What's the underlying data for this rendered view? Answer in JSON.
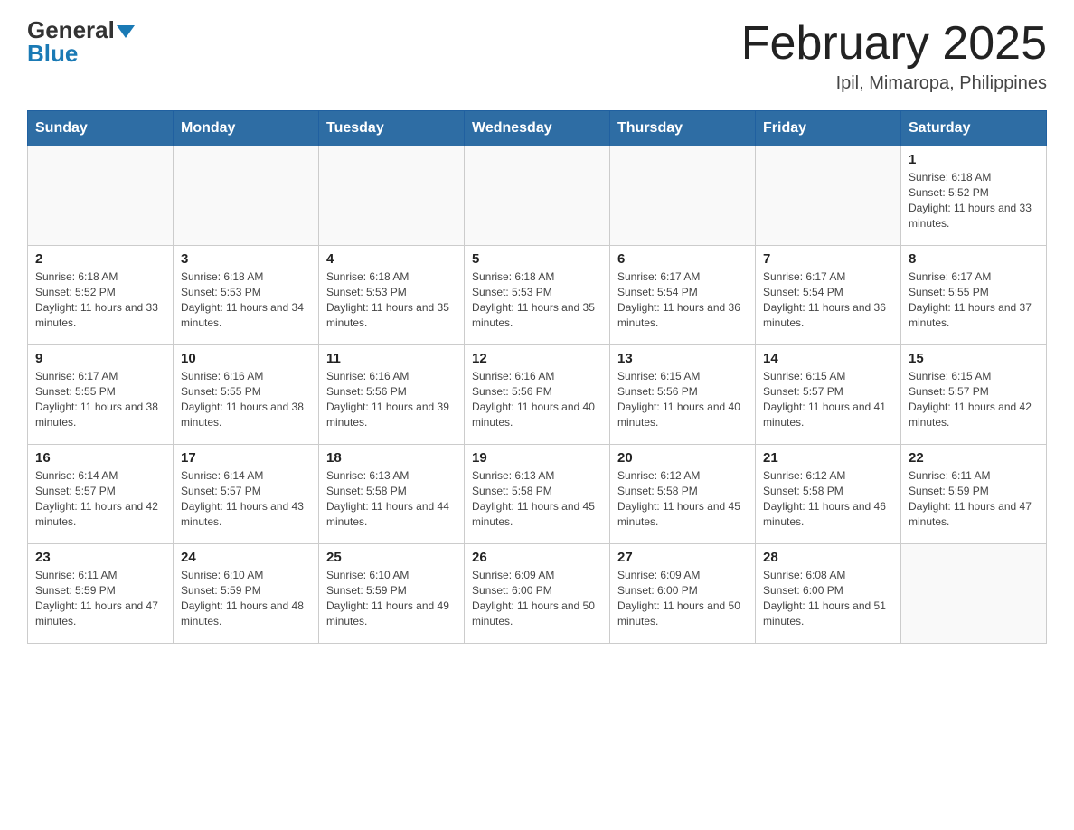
{
  "header": {
    "logo": {
      "general": "General",
      "blue": "Blue"
    },
    "title": "February 2025",
    "subtitle": "Ipil, Mimaropa, Philippines"
  },
  "days_of_week": [
    "Sunday",
    "Monday",
    "Tuesday",
    "Wednesday",
    "Thursday",
    "Friday",
    "Saturday"
  ],
  "weeks": [
    [
      {
        "day": "",
        "info": ""
      },
      {
        "day": "",
        "info": ""
      },
      {
        "day": "",
        "info": ""
      },
      {
        "day": "",
        "info": ""
      },
      {
        "day": "",
        "info": ""
      },
      {
        "day": "",
        "info": ""
      },
      {
        "day": "1",
        "info": "Sunrise: 6:18 AM\nSunset: 5:52 PM\nDaylight: 11 hours and 33 minutes."
      }
    ],
    [
      {
        "day": "2",
        "info": "Sunrise: 6:18 AM\nSunset: 5:52 PM\nDaylight: 11 hours and 33 minutes."
      },
      {
        "day": "3",
        "info": "Sunrise: 6:18 AM\nSunset: 5:53 PM\nDaylight: 11 hours and 34 minutes."
      },
      {
        "day": "4",
        "info": "Sunrise: 6:18 AM\nSunset: 5:53 PM\nDaylight: 11 hours and 35 minutes."
      },
      {
        "day": "5",
        "info": "Sunrise: 6:18 AM\nSunset: 5:53 PM\nDaylight: 11 hours and 35 minutes."
      },
      {
        "day": "6",
        "info": "Sunrise: 6:17 AM\nSunset: 5:54 PM\nDaylight: 11 hours and 36 minutes."
      },
      {
        "day": "7",
        "info": "Sunrise: 6:17 AM\nSunset: 5:54 PM\nDaylight: 11 hours and 36 minutes."
      },
      {
        "day": "8",
        "info": "Sunrise: 6:17 AM\nSunset: 5:55 PM\nDaylight: 11 hours and 37 minutes."
      }
    ],
    [
      {
        "day": "9",
        "info": "Sunrise: 6:17 AM\nSunset: 5:55 PM\nDaylight: 11 hours and 38 minutes."
      },
      {
        "day": "10",
        "info": "Sunrise: 6:16 AM\nSunset: 5:55 PM\nDaylight: 11 hours and 38 minutes."
      },
      {
        "day": "11",
        "info": "Sunrise: 6:16 AM\nSunset: 5:56 PM\nDaylight: 11 hours and 39 minutes."
      },
      {
        "day": "12",
        "info": "Sunrise: 6:16 AM\nSunset: 5:56 PM\nDaylight: 11 hours and 40 minutes."
      },
      {
        "day": "13",
        "info": "Sunrise: 6:15 AM\nSunset: 5:56 PM\nDaylight: 11 hours and 40 minutes."
      },
      {
        "day": "14",
        "info": "Sunrise: 6:15 AM\nSunset: 5:57 PM\nDaylight: 11 hours and 41 minutes."
      },
      {
        "day": "15",
        "info": "Sunrise: 6:15 AM\nSunset: 5:57 PM\nDaylight: 11 hours and 42 minutes."
      }
    ],
    [
      {
        "day": "16",
        "info": "Sunrise: 6:14 AM\nSunset: 5:57 PM\nDaylight: 11 hours and 42 minutes."
      },
      {
        "day": "17",
        "info": "Sunrise: 6:14 AM\nSunset: 5:57 PM\nDaylight: 11 hours and 43 minutes."
      },
      {
        "day": "18",
        "info": "Sunrise: 6:13 AM\nSunset: 5:58 PM\nDaylight: 11 hours and 44 minutes."
      },
      {
        "day": "19",
        "info": "Sunrise: 6:13 AM\nSunset: 5:58 PM\nDaylight: 11 hours and 45 minutes."
      },
      {
        "day": "20",
        "info": "Sunrise: 6:12 AM\nSunset: 5:58 PM\nDaylight: 11 hours and 45 minutes."
      },
      {
        "day": "21",
        "info": "Sunrise: 6:12 AM\nSunset: 5:58 PM\nDaylight: 11 hours and 46 minutes."
      },
      {
        "day": "22",
        "info": "Sunrise: 6:11 AM\nSunset: 5:59 PM\nDaylight: 11 hours and 47 minutes."
      }
    ],
    [
      {
        "day": "23",
        "info": "Sunrise: 6:11 AM\nSunset: 5:59 PM\nDaylight: 11 hours and 47 minutes."
      },
      {
        "day": "24",
        "info": "Sunrise: 6:10 AM\nSunset: 5:59 PM\nDaylight: 11 hours and 48 minutes."
      },
      {
        "day": "25",
        "info": "Sunrise: 6:10 AM\nSunset: 5:59 PM\nDaylight: 11 hours and 49 minutes."
      },
      {
        "day": "26",
        "info": "Sunrise: 6:09 AM\nSunset: 6:00 PM\nDaylight: 11 hours and 50 minutes."
      },
      {
        "day": "27",
        "info": "Sunrise: 6:09 AM\nSunset: 6:00 PM\nDaylight: 11 hours and 50 minutes."
      },
      {
        "day": "28",
        "info": "Sunrise: 6:08 AM\nSunset: 6:00 PM\nDaylight: 11 hours and 51 minutes."
      },
      {
        "day": "",
        "info": ""
      }
    ]
  ]
}
